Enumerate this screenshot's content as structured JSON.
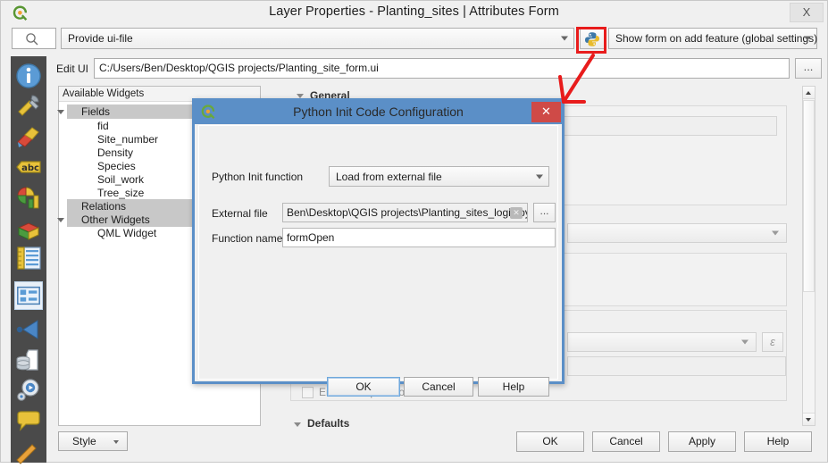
{
  "window": {
    "title": "Layer Properties - Planting_sites | Attributes Form",
    "logo_icon": "qgis-logo-icon",
    "close_label": "X"
  },
  "toolbar": {
    "search_placeholder": "",
    "search_icon": "search-icon",
    "ui_file_combo_value": "Provide ui-file",
    "python_icon": "python-icon",
    "show_form_combo_value": "Show form on add feature (global settings)"
  },
  "edit_ui": {
    "label": "Edit UI",
    "value": "C:/Users/Ben/Desktop/QGIS projects/Planting_site_form.ui",
    "browse_label": "..."
  },
  "icon_rail": {
    "items": [
      {
        "name": "information-icon",
        "label": "Information"
      },
      {
        "name": "source-tools-icon",
        "label": "Source"
      },
      {
        "name": "symbology-brush-icon",
        "label": "Symbology"
      },
      {
        "name": "labels-abc-icon",
        "label": "Labels"
      },
      {
        "name": "diagrams-chart-icon",
        "label": "Diagrams"
      },
      {
        "name": "3d-view-cube-icon",
        "label": "3D View"
      },
      {
        "name": "fields-ruler-icon",
        "label": "Fields"
      },
      {
        "name": "attributes-form-icon",
        "label": "Attributes Form"
      },
      {
        "name": "joins-arrow-icon",
        "label": "Joins"
      },
      {
        "name": "auxiliary-storage-icon",
        "label": "Auxiliary Storage"
      },
      {
        "name": "actions-gear-icon",
        "label": "Actions"
      },
      {
        "name": "display-bubble-icon",
        "label": "Display"
      },
      {
        "name": "rendering-pencil-icon",
        "label": "Rendering"
      }
    ]
  },
  "widgets_panel": {
    "header": "Available Widgets",
    "tree": [
      {
        "label": "Fields",
        "type": "group",
        "expanded": true
      },
      {
        "label": "fid",
        "type": "leaf"
      },
      {
        "label": "Site_number",
        "type": "leaf"
      },
      {
        "label": "Density",
        "type": "leaf"
      },
      {
        "label": "Species",
        "type": "leaf"
      },
      {
        "label": "Soil_work",
        "type": "leaf"
      },
      {
        "label": "Tree_size",
        "type": "leaf"
      },
      {
        "label": "Relations",
        "type": "group",
        "expanded": false
      },
      {
        "label": "Other Widgets",
        "type": "group",
        "expanded": true
      },
      {
        "label": "QML Widget",
        "type": "leaf"
      }
    ]
  },
  "right_panel": {
    "general_section": "General",
    "enforce_expression_constraint": "Enforce expression constraint",
    "defaults_section": "Defaults",
    "expression_button": "ε"
  },
  "python_dialog": {
    "title": "Python Init Code Configuration",
    "logo_icon": "qgis-logo-icon",
    "close_label": "✕",
    "init_function_label": "Python Init function",
    "init_function_value": "Load from external file",
    "external_file_label": "External file",
    "external_file_value": "Ben\\Desktop\\QGIS projects\\Planting_sites_logic.py",
    "external_file_clear_icon": "clear-icon",
    "external_file_browse": "...",
    "function_name_label": "Function name",
    "function_name_value": "formOpen",
    "ok_label": "OK",
    "cancel_label": "Cancel",
    "help_label": "Help"
  },
  "bottom_bar": {
    "style_label": "Style",
    "ok_label": "OK",
    "cancel_label": "Cancel",
    "apply_label": "Apply",
    "help_label": "Help"
  },
  "annotation": {
    "highlight_color": "#e81c1c",
    "target": "python-init-code-button"
  }
}
